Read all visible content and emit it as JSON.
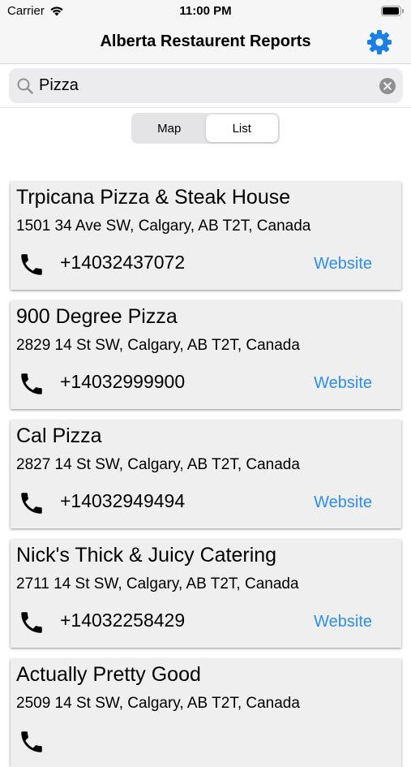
{
  "status_bar": {
    "carrier": "Carrier",
    "time": "11:00 PM"
  },
  "nav": {
    "title": "Alberta Restaurent Reports",
    "settings_icon": "gear-icon",
    "accent_color": "#1a7fe6"
  },
  "search": {
    "value": "Pizza",
    "placeholder": "Search"
  },
  "segmented_control": {
    "options": [
      "Map",
      "List"
    ],
    "selected": "List"
  },
  "restaurants": [
    {
      "name": "Trpicana Pizza & Steak House",
      "address": "1501 34 Ave SW, Calgary, AB T2T, Canada",
      "phone": "+14032437072",
      "website_label": "Website"
    },
    {
      "name": "900 Degree Pizza",
      "address": "2829 14 St SW, Calgary, AB T2T, Canada",
      "phone": "+14032999900",
      "website_label": "Website"
    },
    {
      "name": "Cal Pizza",
      "address": "2827 14 St SW, Calgary, AB T2T, Canada",
      "phone": "+14032949494",
      "website_label": "Website"
    },
    {
      "name": "Nick's Thick & Juicy Catering",
      "address": "2711 14 St SW, Calgary, AB T2T, Canada",
      "phone": "+14032258429",
      "website_label": "Website"
    },
    {
      "name": "Actually Pretty Good",
      "address": "2509 14 St SW, Calgary, AB T2T, Canada",
      "phone": "",
      "website_label": ""
    }
  ],
  "colors": {
    "link": "#2d8ef0",
    "card_background": "#efefef"
  }
}
